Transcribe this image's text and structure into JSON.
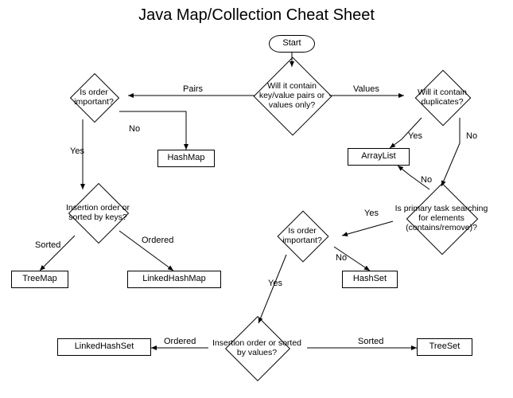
{
  "title": "Java Map/Collection Cheat Sheet",
  "nodes": {
    "start": "Start",
    "q_contain": "Will it contain key/value pairs or values only?",
    "q_order_pairs": "Is order important?",
    "q_duplicates": "Will it contain duplicates?",
    "hashmap": "HashMap",
    "arraylist": "ArrayList",
    "q_insert_keys": "Insertion order or sorted by keys?",
    "q_primary": "Is primary task searching for elements (contains/remove)?",
    "treemap": "TreeMap",
    "linkedhashmap": "LinkedHashMap",
    "q_order_set": "Is order important?",
    "hashset": "HashSet",
    "q_insert_values": "Insertion order or sorted by values?",
    "linkedhashset": "LinkedHashSet",
    "treeset": "TreeSet"
  },
  "edges": {
    "pairs": "Pairs",
    "values": "Values",
    "yes": "Yes",
    "no": "No",
    "sorted": "Sorted",
    "ordered": "Ordered"
  }
}
